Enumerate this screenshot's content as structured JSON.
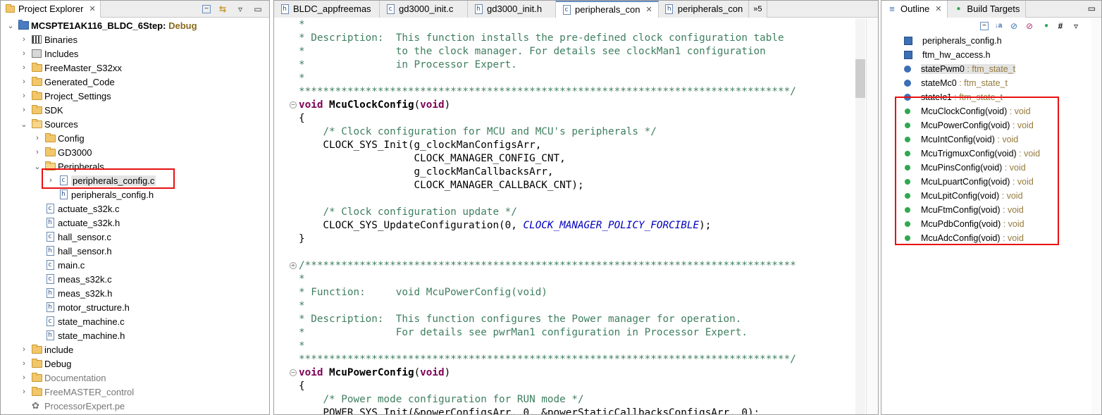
{
  "project_explorer": {
    "tab_title": "Project Explorer",
    "tree": [
      {
        "label": "MCSPTE1AK116_BLDC_6Step",
        "decoration": " Debug",
        "type": "project",
        "expanded": true
      },
      {
        "label": "Binaries",
        "type": "binaries"
      },
      {
        "label": "Includes",
        "type": "includes"
      },
      {
        "label": "FreeMaster_S32xx",
        "type": "folder"
      },
      {
        "label": "Generated_Code",
        "type": "folder"
      },
      {
        "label": "Project_Settings",
        "type": "folder"
      },
      {
        "label": "SDK",
        "type": "folder"
      },
      {
        "label": "Sources",
        "type": "folder",
        "expanded": true
      },
      {
        "label": "Config",
        "type": "folder"
      },
      {
        "label": "GD3000",
        "type": "folder"
      },
      {
        "label": "Peripherals",
        "type": "folder",
        "expanded": true
      },
      {
        "label": "peripherals_config.c",
        "type": "c-file",
        "selected": true
      },
      {
        "label": "peripherals_config.h",
        "type": "h-file"
      },
      {
        "label": "actuate_s32k.c",
        "type": "c-file"
      },
      {
        "label": "actuate_s32k.h",
        "type": "h-file"
      },
      {
        "label": "hall_sensor.c",
        "type": "c-file"
      },
      {
        "label": "hall_sensor.h",
        "type": "h-file"
      },
      {
        "label": "main.c",
        "type": "c-file"
      },
      {
        "label": "meas_s32k.c",
        "type": "c-file"
      },
      {
        "label": "meas_s32k.h",
        "type": "h-file"
      },
      {
        "label": "motor_structure.h",
        "type": "h-file"
      },
      {
        "label": "state_machine.c",
        "type": "c-file"
      },
      {
        "label": "state_machine.h",
        "type": "h-file"
      },
      {
        "label": "include",
        "type": "folder"
      },
      {
        "label": "Debug",
        "type": "folder"
      },
      {
        "label": "Documentation",
        "type": "folder"
      },
      {
        "label": "FreeMASTER_control",
        "type": "folder"
      },
      {
        "label": "ProcessorExpert.pe",
        "type": "pe-file"
      }
    ]
  },
  "editor": {
    "tabs": [
      {
        "label": "BLDC_appfreemas",
        "icon": "h"
      },
      {
        "label": "gd3000_init.c",
        "icon": "c"
      },
      {
        "label": "gd3000_init.h",
        "icon": "h"
      },
      {
        "label": "peripherals_con",
        "icon": "c",
        "active": true
      },
      {
        "label": "peripherals_con",
        "icon": "h"
      }
    ],
    "overflow_label": "»5",
    "code_lines": [
      [
        {
          "t": "*",
          "c": "cm"
        }
      ],
      [
        {
          "t": "* Description:  This function installs the pre-defined clock configuration table",
          "c": "cm"
        }
      ],
      [
        {
          "t": "*               to the clock manager. For details see clockMan1 configuration",
          "c": "cm"
        }
      ],
      [
        {
          "t": "*               in Processor Expert.",
          "c": "cm"
        }
      ],
      [
        {
          "t": "*",
          "c": "cm"
        }
      ],
      [
        {
          "t": "*********************************************************************************/",
          "c": "cm"
        }
      ],
      [
        {
          "t": "void",
          "c": "kw"
        },
        {
          "t": " "
        },
        {
          "t": "McuClockConfig",
          "c": "fn"
        },
        {
          "t": "("
        },
        {
          "t": "void",
          "c": "kw"
        },
        {
          "t": ")"
        }
      ],
      [
        {
          "t": "{"
        }
      ],
      [
        {
          "t": "    "
        },
        {
          "t": "/* Clock configuration for MCU and MCU's peripherals */",
          "c": "cm"
        }
      ],
      [
        {
          "t": "    CLOCK_SYS_Init(g_clockManConfigsArr,"
        }
      ],
      [
        {
          "t": "                   CLOCK_MANAGER_CONFIG_CNT,"
        }
      ],
      [
        {
          "t": "                   g_clockManCallbacksArr,"
        }
      ],
      [
        {
          "t": "                   CLOCK_MANAGER_CALLBACK_CNT);"
        }
      ],
      [
        {
          "t": ""
        }
      ],
      [
        {
          "t": "    "
        },
        {
          "t": "/* Clock configuration update */",
          "c": "cm"
        }
      ],
      [
        {
          "t": "    CLOCK_SYS_UpdateConfiguration(0, "
        },
        {
          "t": "CLOCK_MANAGER_POLICY_FORCIBLE",
          "c": "en"
        },
        {
          "t": ");"
        }
      ],
      [
        {
          "t": "}"
        }
      ],
      [
        {
          "t": ""
        }
      ],
      [
        {
          "t": "/*********************************************************************************",
          "c": "cm"
        }
      ],
      [
        {
          "t": "*",
          "c": "cm"
        }
      ],
      [
        {
          "t": "* Function:     void McuPowerConfig(void)",
          "c": "cm"
        }
      ],
      [
        {
          "t": "*",
          "c": "cm"
        }
      ],
      [
        {
          "t": "* Description:  This function configures the Power manager for operation.",
          "c": "cm"
        }
      ],
      [
        {
          "t": "*               For details see pwrMan1 configuration in Processor Expert.",
          "c": "cm"
        }
      ],
      [
        {
          "t": "*",
          "c": "cm"
        }
      ],
      [
        {
          "t": "*********************************************************************************/",
          "c": "cm"
        }
      ],
      [
        {
          "t": "void",
          "c": "kw"
        },
        {
          "t": " "
        },
        {
          "t": "McuPowerConfig",
          "c": "fn"
        },
        {
          "t": "("
        },
        {
          "t": "void",
          "c": "kw"
        },
        {
          "t": ")"
        }
      ],
      [
        {
          "t": "{"
        }
      ],
      [
        {
          "t": "    "
        },
        {
          "t": "/* Power mode configuration for RUN mode */",
          "c": "cm"
        }
      ],
      [
        {
          "t": "    POWER_SYS_Init(&powerConfigsArr, 0, &powerStaticCallbacksConfigsArr, 0);"
        }
      ]
    ]
  },
  "outline": {
    "tabs": [
      {
        "label": "Outline",
        "active": true
      },
      {
        "label": "Build Targets"
      }
    ],
    "items": [
      {
        "name": "peripherals_config.h",
        "type": "",
        "kind": "header"
      },
      {
        "name": "ftm_hw_access.h",
        "type": "",
        "kind": "header"
      },
      {
        "name": "statePwm0",
        "type": " : ftm_state_t",
        "kind": "variable",
        "selected": true
      },
      {
        "name": "stateMc0",
        "type": " : ftm_state_t",
        "kind": "variable"
      },
      {
        "name": "stateIc1",
        "type": " : ftm_state_t",
        "kind": "variable"
      },
      {
        "name": "McuClockConfig(void)",
        "type": " : void",
        "kind": "function"
      },
      {
        "name": "McuPowerConfig(void)",
        "type": " : void",
        "kind": "function"
      },
      {
        "name": "McuIntConfig(void)",
        "type": " : void",
        "kind": "function"
      },
      {
        "name": "McuTrigmuxConfig(void)",
        "type": " : void",
        "kind": "function"
      },
      {
        "name": "McuPinsConfig(void)",
        "type": " : void",
        "kind": "function"
      },
      {
        "name": "McuLpuartConfig(void)",
        "type": " : void",
        "kind": "function"
      },
      {
        "name": "McuLpitConfig(void)",
        "type": " : void",
        "kind": "function"
      },
      {
        "name": "McuFtmConfig(void)",
        "type": " : void",
        "kind": "function"
      },
      {
        "name": "McuPdbConfig(void)",
        "type": " : void",
        "kind": "function"
      },
      {
        "name": "McuAdcConfig(void)",
        "type": " : void",
        "kind": "function"
      }
    ]
  },
  "colors": {
    "highlight_box": "#e81010",
    "comment": "#3f7f5f",
    "keyword": "#7f0055",
    "enum_constant": "#0000c0",
    "type_decoration": "#957a3d"
  }
}
